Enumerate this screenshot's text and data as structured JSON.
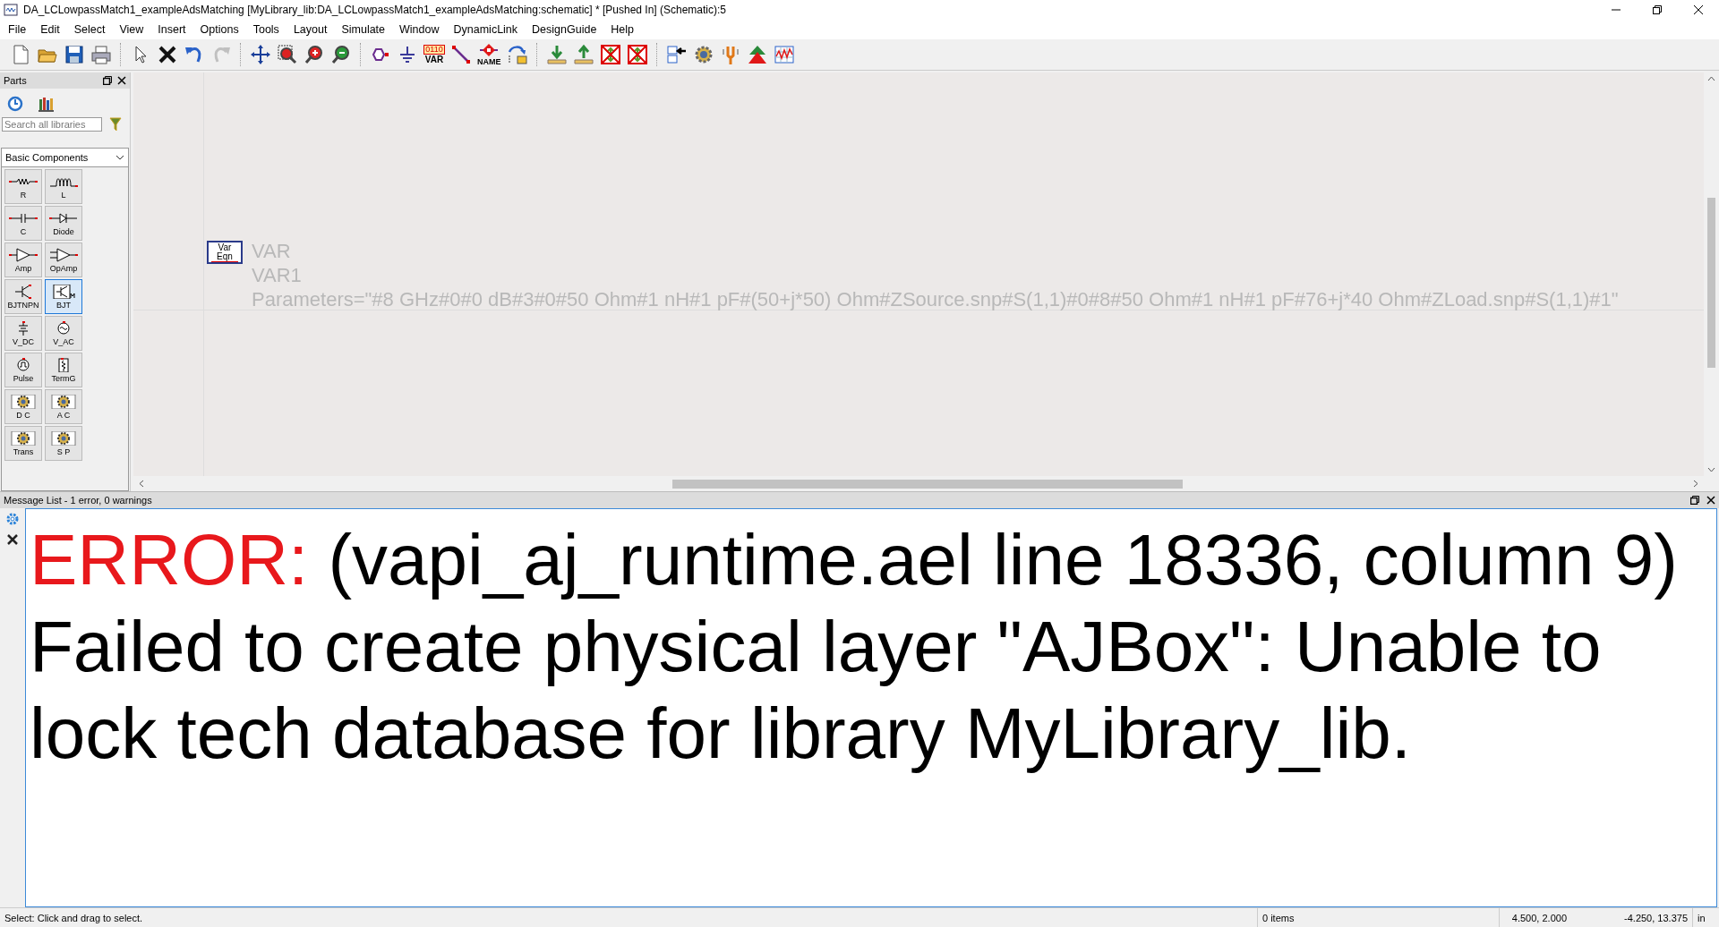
{
  "window": {
    "title": "DA_LCLowpassMatch1_exampleAdsMatching [MyLibrary_lib:DA_LCLowpassMatch1_exampleAdsMatching:schematic] * [Pushed In] (Schematic):5"
  },
  "menu": [
    "File",
    "Edit",
    "Select",
    "View",
    "Insert",
    "Options",
    "Tools",
    "Layout",
    "Simulate",
    "Window",
    "DynamicLink",
    "DesignGuide",
    "Help"
  ],
  "toolbar": [
    {
      "kind": "new",
      "disabled": false
    },
    {
      "kind": "open",
      "disabled": false
    },
    {
      "kind": "save",
      "disabled": false
    },
    {
      "kind": "print",
      "disabled": false
    },
    {
      "kind": "separator"
    },
    {
      "kind": "select",
      "disabled": false
    },
    {
      "kind": "delete",
      "disabled": false
    },
    {
      "kind": "undo",
      "disabled": false
    },
    {
      "kind": "redo",
      "disabled": true
    },
    {
      "kind": "separator"
    },
    {
      "kind": "pan",
      "disabled": false
    },
    {
      "kind": "zoom-area",
      "disabled": false
    },
    {
      "kind": "zoom-in",
      "disabled": false
    },
    {
      "kind": "zoom-out",
      "disabled": false
    },
    {
      "kind": "separator"
    },
    {
      "kind": "port",
      "disabled": false
    },
    {
      "kind": "ground",
      "disabled": false
    },
    {
      "kind": "var",
      "disabled": false,
      "labels": [
        "0110",
        "VAR"
      ]
    },
    {
      "kind": "wire",
      "disabled": false
    },
    {
      "kind": "name",
      "disabled": false,
      "labels": [
        "NAME"
      ]
    },
    {
      "kind": "push",
      "disabled": false
    },
    {
      "kind": "separator"
    },
    {
      "kind": "import",
      "disabled": false
    },
    {
      "kind": "export",
      "disabled": false
    },
    {
      "kind": "deactivate",
      "disabled": false
    },
    {
      "kind": "deactivate",
      "disabled": false
    },
    {
      "kind": "separator"
    },
    {
      "kind": "back",
      "disabled": false
    },
    {
      "kind": "simulate",
      "disabled": false
    },
    {
      "kind": "tune",
      "disabled": false
    },
    {
      "kind": "up",
      "disabled": false
    },
    {
      "kind": "results",
      "disabled": false
    }
  ],
  "parts_panel": {
    "title": "Parts",
    "search": {
      "placeholder": "Search all libraries"
    },
    "library": "Basic Components",
    "parts": [
      {
        "label": "R",
        "kind": "resistor",
        "selected": false
      },
      {
        "label": "L",
        "kind": "inductor",
        "selected": false
      },
      {
        "label": "C",
        "kind": "capacitor",
        "selected": false
      },
      {
        "label": "Diode",
        "kind": "diode",
        "selected": false
      },
      {
        "label": "Amp",
        "kind": "amp",
        "selected": false
      },
      {
        "label": "OpAmp",
        "kind": "opamp",
        "selected": false
      },
      {
        "label": "BJTNPN",
        "kind": "bjt",
        "selected": false
      },
      {
        "label": "BJT",
        "kind": "bjt-model",
        "selected": true
      },
      {
        "label": "V_DC",
        "kind": "vdc",
        "selected": false
      },
      {
        "label": "V_AC",
        "kind": "vac",
        "selected": false
      },
      {
        "label": "Pulse",
        "kind": "pulse",
        "selected": false
      },
      {
        "label": "TermG",
        "kind": "term",
        "selected": false
      },
      {
        "label": "D C",
        "kind": "sim",
        "selected": false
      },
      {
        "label": "A C",
        "kind": "sim",
        "selected": false
      },
      {
        "label": "Trans",
        "kind": "sim",
        "selected": false
      },
      {
        "label": "S P",
        "kind": "sim",
        "selected": false
      }
    ]
  },
  "canvas": {
    "component": {
      "symbol": [
        "Var",
        "Eqn"
      ],
      "type": "VAR",
      "instance": "VAR1",
      "parameters": "Parameters=\"#8 GHz#0#0 dB#3#0#50 Ohm#1 nH#1 pF#(50+j*50) Ohm#ZSource.snp#S(1,1)#0#8#50 Ohm#1 nH#1 pF#76+j*40 Ohm#ZLoad.snp#S(1,1)#1\""
    }
  },
  "message_list": {
    "title": "Message List - 1 error, 0 warnings",
    "messages": [
      {
        "severity": "ERROR:",
        "text": "(vapi_aj_runtime.ael line 18336, column 9) Failed to create physical layer \"AJBox\": Unable to lock tech database for library MyLibrary_lib."
      }
    ]
  },
  "status_bar": {
    "hint": "Select: Click and drag to select.",
    "items": "0 items",
    "position": "4.500, 2.000",
    "cursor": "-4.250, 13.375",
    "units": "in"
  }
}
